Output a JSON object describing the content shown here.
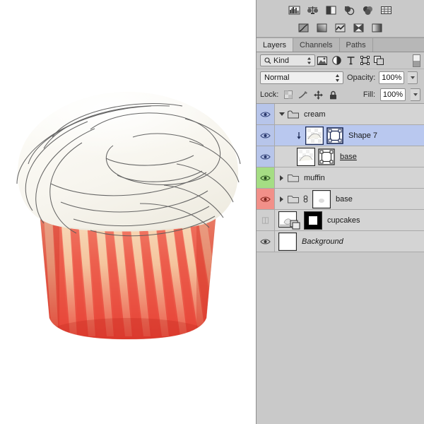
{
  "panel": {
    "tabs": [
      {
        "label": "Layers",
        "active": true
      },
      {
        "label": "Channels",
        "active": false
      },
      {
        "label": "Paths",
        "active": false
      }
    ],
    "filter": {
      "kind_label": "Kind",
      "icons": [
        "pixel-filter-icon",
        "adjustment-filter-icon",
        "type-filter-icon",
        "shape-filter-icon",
        "smartobject-filter-icon"
      ],
      "toggle": "filter-enable-toggle"
    },
    "blend": {
      "mode": "Normal",
      "opacity_label": "Opacity:",
      "opacity_value": "100%",
      "fill_label": "Fill:",
      "fill_value": "100%"
    },
    "lock": {
      "label": "Lock:",
      "icons": [
        "lock-transparent-pixels-icon",
        "lock-image-pixels-icon",
        "lock-position-icon",
        "lock-all-icon"
      ]
    },
    "toolbar_top": [
      "histogram-icon",
      "levels-icon",
      "brightness-contrast-icon",
      "photo-filter-icon",
      "color-balance-icon",
      "grid-icon"
    ],
    "toolbar_bottom": [
      "curves-icon",
      "gradient-map-icon",
      "selective-color-icon",
      "invert-icon",
      "gradient-icon"
    ]
  },
  "layers": [
    {
      "name": "cream",
      "type": "group",
      "visible": true,
      "eye_color": "blue",
      "selected": false,
      "expanded": true,
      "indent": 0,
      "has_thumb": false,
      "italic": false,
      "underline": false
    },
    {
      "name": "Shape 7",
      "type": "shape-clipped",
      "visible": true,
      "eye_color": "blue",
      "selected": true,
      "expanded": null,
      "indent": 1,
      "has_thumb": true,
      "italic": false,
      "underline": false
    },
    {
      "name": "base",
      "type": "shape",
      "visible": true,
      "eye_color": "blue",
      "selected": false,
      "expanded": null,
      "indent": 1,
      "has_thumb": true,
      "italic": false,
      "underline": true
    },
    {
      "name": "muffin",
      "type": "group",
      "visible": true,
      "eye_color": "green",
      "selected": false,
      "expanded": false,
      "indent": 0,
      "has_thumb": false,
      "italic": false,
      "underline": false
    },
    {
      "name": "base",
      "type": "group-linked-mask",
      "visible": true,
      "eye_color": "red",
      "selected": false,
      "expanded": false,
      "indent": 0,
      "has_thumb": true,
      "italic": false,
      "underline": false
    },
    {
      "name": "cupcakes",
      "type": "smart-object-masked",
      "visible": false,
      "eye_color": "none",
      "selected": false,
      "expanded": null,
      "indent": 0,
      "has_thumb": true,
      "italic": false,
      "underline": false
    },
    {
      "name": "Background",
      "type": "background",
      "visible": true,
      "eye_color": "none",
      "selected": false,
      "expanded": null,
      "indent": 0,
      "has_thumb": true,
      "italic": true,
      "underline": false
    }
  ],
  "canvas": {
    "artwork_name": "cupcake-illustration",
    "background": "#ffffff",
    "cream_color": "#f7f5ef",
    "muffin_color": "#eec694",
    "wrapper_color": "#ef5744"
  },
  "colors": {
    "panel_bg": "#c9c9c9",
    "row_bg": "#d4d4d4",
    "selected_row": "#b9c8ef",
    "eye_blue": "#b7c5ea",
    "eye_green": "#a5dd84",
    "eye_red": "#f29089",
    "border": "#a9a9a9"
  }
}
